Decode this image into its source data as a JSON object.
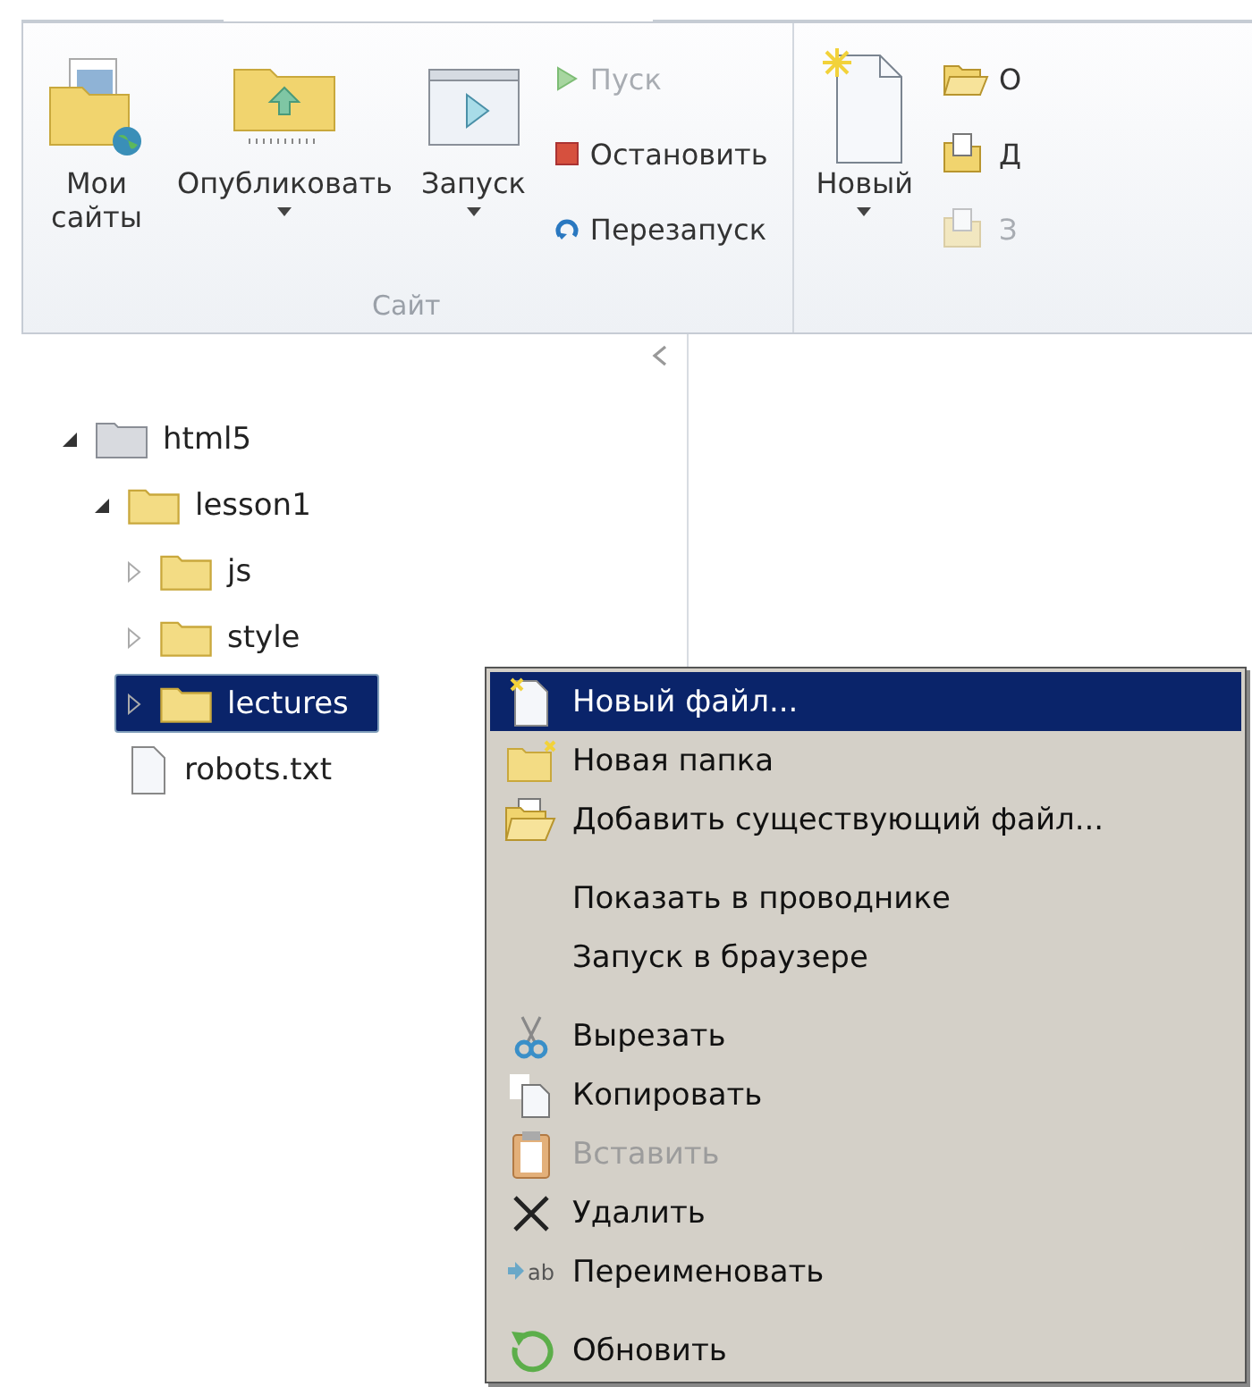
{
  "ribbon": {
    "groups": [
      {
        "label": "Сайт",
        "large": [
          {
            "label": "Мои сайты",
            "dropdown": false
          },
          {
            "label": "Опубликовать",
            "dropdown": true
          },
          {
            "label": "Запуск",
            "dropdown": true
          }
        ],
        "small": [
          {
            "label": "Пуск",
            "disabled": true
          },
          {
            "label": "Остановить",
            "disabled": false
          },
          {
            "label": "Перезапуск",
            "disabled": false
          }
        ]
      },
      {
        "large": [
          {
            "label": "Новый",
            "dropdown": true
          }
        ],
        "small": [
          {
            "label": "О",
            "disabled": false
          },
          {
            "label": "Д",
            "disabled": false
          },
          {
            "label": "З",
            "disabled": true
          }
        ]
      }
    ]
  },
  "tree": [
    {
      "label": "html5",
      "kind": "site",
      "expanded": true,
      "selected": false,
      "children": [
        {
          "label": "lesson1",
          "kind": "folder",
          "expanded": true,
          "selected": false,
          "children": [
            {
              "label": "js",
              "kind": "folder",
              "expanded": false,
              "selected": false
            },
            {
              "label": "style",
              "kind": "folder",
              "expanded": false,
              "selected": false
            },
            {
              "label": "lectures",
              "kind": "folder",
              "expanded": false,
              "selected": true
            }
          ]
        },
        {
          "label": "robots.txt",
          "kind": "file",
          "selected": false
        }
      ]
    }
  ],
  "context_menu": {
    "groups": [
      [
        {
          "label": "Новый файл...",
          "selected": true,
          "disabled": false
        },
        {
          "label": "Новая папка",
          "selected": false,
          "disabled": false
        },
        {
          "label": "Добавить существующий файл...",
          "selected": false,
          "disabled": false
        }
      ],
      [
        {
          "label": "Показать в проводнике",
          "selected": false,
          "disabled": false
        },
        {
          "label": "Запуск в браузере",
          "selected": false,
          "disabled": false
        }
      ],
      [
        {
          "label": "Вырезать",
          "selected": false,
          "disabled": false
        },
        {
          "label": "Копировать",
          "selected": false,
          "disabled": false
        },
        {
          "label": "Вставить",
          "selected": false,
          "disabled": true
        },
        {
          "label": "Удалить",
          "selected": false,
          "disabled": false
        },
        {
          "label": "Переименовать",
          "selected": false,
          "disabled": false,
          "icon_label": "ab"
        }
      ],
      [
        {
          "label": "Обновить",
          "selected": false,
          "disabled": false
        }
      ]
    ]
  }
}
